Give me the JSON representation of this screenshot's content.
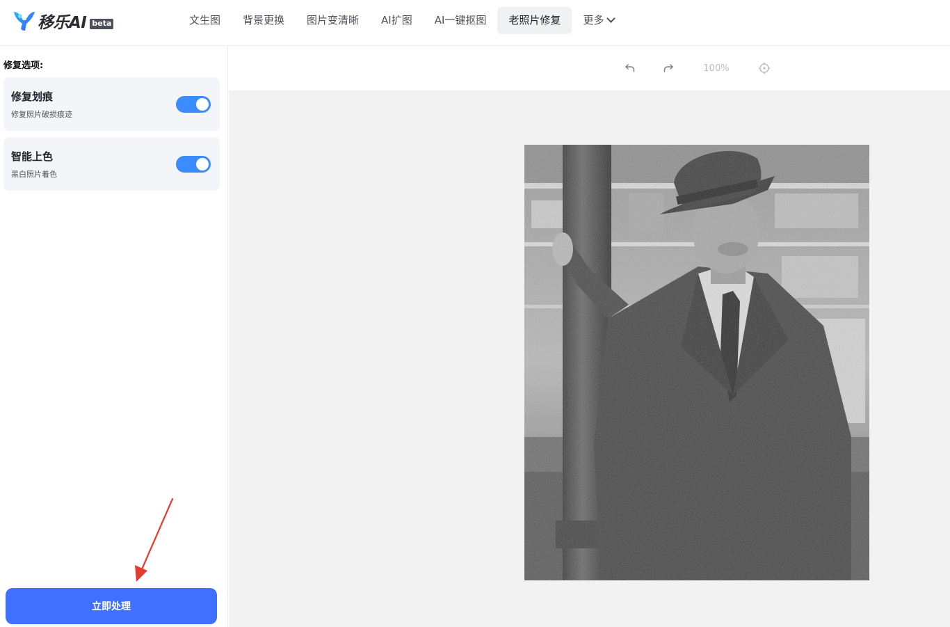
{
  "app": {
    "logo_text": "移乐AI",
    "badge": "beta"
  },
  "nav": {
    "items": [
      {
        "label": "文生图"
      },
      {
        "label": "背景更换"
      },
      {
        "label": "图片变清晰"
      },
      {
        "label": "AI扩图"
      },
      {
        "label": "AI一键抠图"
      },
      {
        "label": "老照片修复",
        "active": true
      },
      {
        "label": "更多"
      }
    ]
  },
  "sidebar": {
    "title": "修复选项:",
    "options": [
      {
        "title": "修复划痕",
        "desc": "修复照片破损痕迹",
        "enabled": true
      },
      {
        "title": "智能上色",
        "desc": "黑白照片着色",
        "enabled": true
      }
    ],
    "process_label": "立即处理"
  },
  "toolbar": {
    "zoom": "100%",
    "icons": [
      "undo-icon",
      "redo-icon",
      "locate-icon"
    ]
  },
  "colors": {
    "accent": "#3f70ff",
    "toggle_on": "#3a8cff",
    "annotation_arrow": "#e53b2c",
    "canvas_bg": "#f2f2f2"
  }
}
